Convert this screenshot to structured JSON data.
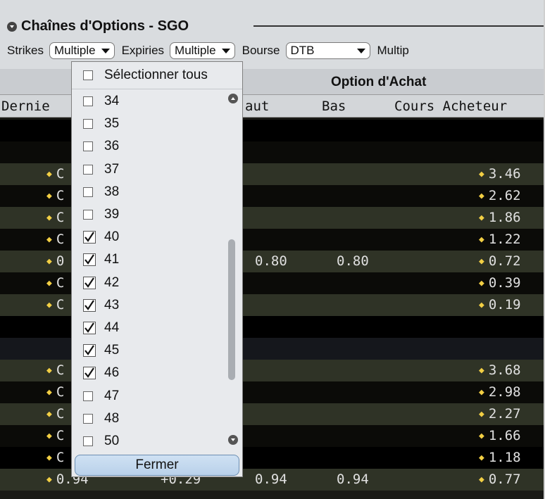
{
  "panel": {
    "title": "Chaînes d'Options - SGO"
  },
  "controls": {
    "strikes_label": "Strikes",
    "strikes_value": "Multiple",
    "expiries_label": "Expiries",
    "expiries_value": "Multiple",
    "exchange_label": "Bourse",
    "exchange_value": "DTB",
    "multiplier_label": "Multip"
  },
  "table": {
    "group_header": "Option d'Achat",
    "columns": [
      "Dernie",
      "aut",
      "Bas",
      "Cours Acheteur"
    ],
    "rows": [
      {
        "last": "",
        "change": "",
        "high": "",
        "low": "",
        "bid": "",
        "bg": "#000000",
        "diamond_left": false,
        "diamond_right": false
      },
      {
        "last": "",
        "change": "",
        "high": "",
        "low": "",
        "bid": "",
        "bg": "#0b0b08",
        "diamond_left": false,
        "diamond_right": false
      },
      {
        "last": "C",
        "change": "",
        "high": "",
        "low": "",
        "bid": "3.46",
        "bg": "#2f3326",
        "diamond_left": true,
        "diamond_right": true
      },
      {
        "last": "C",
        "change": "",
        "high": "",
        "low": "",
        "bid": "2.62",
        "bg": "#0b0b08",
        "diamond_left": true,
        "diamond_right": true
      },
      {
        "last": "C",
        "change": "",
        "high": "",
        "low": "",
        "bid": "1.86",
        "bg": "#2f3326",
        "diamond_left": true,
        "diamond_right": true
      },
      {
        "last": "C",
        "change": "",
        "high": "",
        "low": "",
        "bid": "1.22",
        "bg": "#0b0b08",
        "diamond_left": true,
        "diamond_right": true
      },
      {
        "last": "0",
        "change": "",
        "high": "0.80",
        "low": "0.80",
        "bid": "0.72",
        "bg": "#2f3326",
        "diamond_left": true,
        "diamond_right": true
      },
      {
        "last": "C",
        "change": "",
        "high": "",
        "low": "",
        "bid": "0.39",
        "bg": "#0b0b08",
        "diamond_left": true,
        "diamond_right": true
      },
      {
        "last": "C",
        "change": "",
        "high": "",
        "low": "",
        "bid": "0.19",
        "bg": "#2f3326",
        "diamond_left": true,
        "diamond_right": true
      },
      {
        "last": "",
        "change": "",
        "high": "",
        "low": "",
        "bid": "",
        "bg": "#000000",
        "diamond_left": false,
        "diamond_right": false
      },
      {
        "last": "",
        "change": "",
        "high": "",
        "low": "",
        "bid": "",
        "bg": "#15171c",
        "diamond_left": false,
        "diamond_right": false
      },
      {
        "last": "C",
        "change": "",
        "high": "",
        "low": "",
        "bid": "3.68",
        "bg": "#2f3326",
        "diamond_left": true,
        "diamond_right": true
      },
      {
        "last": "C",
        "change": "",
        "high": "",
        "low": "",
        "bid": "2.98",
        "bg": "#0b0b08",
        "diamond_left": true,
        "diamond_right": true
      },
      {
        "last": "C",
        "change": "",
        "high": "",
        "low": "",
        "bid": "2.27",
        "bg": "#2f3326",
        "diamond_left": true,
        "diamond_right": true
      },
      {
        "last": "C",
        "change": "",
        "high": "",
        "low": "",
        "bid": "1.66",
        "bg": "#0b0b08",
        "diamond_left": true,
        "diamond_right": true
      },
      {
        "last": "C",
        "change": "",
        "high": "",
        "low": "",
        "bid": "1.18",
        "bg": "#000000",
        "diamond_left": true,
        "diamond_right": true
      },
      {
        "last": "0.94",
        "change": "+0.29",
        "high": "0.94",
        "low": "0.94",
        "bid": "0.77",
        "bg": "#2f3326",
        "diamond_left": true,
        "diamond_right": true
      }
    ]
  },
  "strikes_dropdown": {
    "select_all": "Sélectionner tous",
    "items": [
      {
        "label": "34",
        "checked": false
      },
      {
        "label": "35",
        "checked": false
      },
      {
        "label": "36",
        "checked": false
      },
      {
        "label": "37",
        "checked": false
      },
      {
        "label": "38",
        "checked": false
      },
      {
        "label": "39",
        "checked": false
      },
      {
        "label": "40",
        "checked": true
      },
      {
        "label": "41",
        "checked": true
      },
      {
        "label": "42",
        "checked": true
      },
      {
        "label": "43",
        "checked": true
      },
      {
        "label": "44",
        "checked": true
      },
      {
        "label": "45",
        "checked": true
      },
      {
        "label": "46",
        "checked": true
      },
      {
        "label": "47",
        "checked": false
      },
      {
        "label": "48",
        "checked": false
      },
      {
        "label": "50",
        "checked": false
      }
    ],
    "close_label": "Fermer"
  },
  "colors": {
    "diamond": "#f2cf44",
    "row_text": "#e0e0e0",
    "header_bg": "#d9dcdf"
  }
}
